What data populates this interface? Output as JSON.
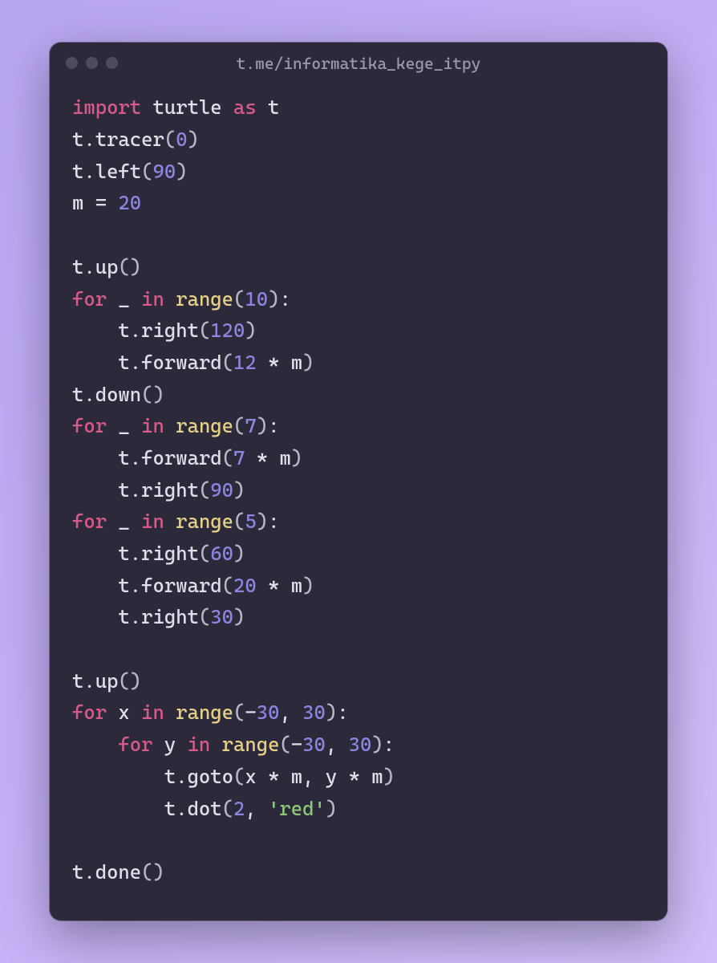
{
  "window": {
    "title": "t.me/informatika_kege_itpy"
  },
  "code": {
    "lines": [
      [
        [
          "kw",
          "import"
        ],
        [
          "var",
          " turtle "
        ],
        [
          "kw",
          "as"
        ],
        [
          "var",
          " t"
        ]
      ],
      [
        [
          "var",
          "t"
        ],
        [
          "op",
          "."
        ],
        [
          "fn",
          "tracer"
        ],
        [
          "paren",
          "("
        ],
        [
          "num",
          "0"
        ],
        [
          "paren",
          ")"
        ]
      ],
      [
        [
          "var",
          "t"
        ],
        [
          "op",
          "."
        ],
        [
          "fn",
          "left"
        ],
        [
          "paren",
          "("
        ],
        [
          "num",
          "90"
        ],
        [
          "paren",
          ")"
        ]
      ],
      [
        [
          "var",
          "m "
        ],
        [
          "op",
          "="
        ],
        [
          "var",
          " "
        ],
        [
          "num",
          "20"
        ]
      ],
      [
        [
          "var",
          ""
        ]
      ],
      [
        [
          "var",
          "t"
        ],
        [
          "op",
          "."
        ],
        [
          "fn",
          "up"
        ],
        [
          "paren",
          "()"
        ]
      ],
      [
        [
          "kw",
          "for"
        ],
        [
          "var",
          " _ "
        ],
        [
          "kw",
          "in"
        ],
        [
          "var",
          " "
        ],
        [
          "builtin",
          "range"
        ],
        [
          "paren",
          "("
        ],
        [
          "num",
          "10"
        ],
        [
          "paren",
          ")"
        ],
        [
          "op",
          ":"
        ]
      ],
      [
        [
          "var",
          "    t"
        ],
        [
          "op",
          "."
        ],
        [
          "fn",
          "right"
        ],
        [
          "paren",
          "("
        ],
        [
          "num",
          "120"
        ],
        [
          "paren",
          ")"
        ]
      ],
      [
        [
          "var",
          "    t"
        ],
        [
          "op",
          "."
        ],
        [
          "fn",
          "forward"
        ],
        [
          "paren",
          "("
        ],
        [
          "num",
          "12"
        ],
        [
          "op",
          " * "
        ],
        [
          "var",
          "m"
        ],
        [
          "paren",
          ")"
        ]
      ],
      [
        [
          "var",
          "t"
        ],
        [
          "op",
          "."
        ],
        [
          "fn",
          "down"
        ],
        [
          "paren",
          "()"
        ]
      ],
      [
        [
          "kw",
          "for"
        ],
        [
          "var",
          " _ "
        ],
        [
          "kw",
          "in"
        ],
        [
          "var",
          " "
        ],
        [
          "builtin",
          "range"
        ],
        [
          "paren",
          "("
        ],
        [
          "num",
          "7"
        ],
        [
          "paren",
          ")"
        ],
        [
          "op",
          ":"
        ]
      ],
      [
        [
          "var",
          "    t"
        ],
        [
          "op",
          "."
        ],
        [
          "fn",
          "forward"
        ],
        [
          "paren",
          "("
        ],
        [
          "num",
          "7"
        ],
        [
          "op",
          " * "
        ],
        [
          "var",
          "m"
        ],
        [
          "paren",
          ")"
        ]
      ],
      [
        [
          "var",
          "    t"
        ],
        [
          "op",
          "."
        ],
        [
          "fn",
          "right"
        ],
        [
          "paren",
          "("
        ],
        [
          "num",
          "90"
        ],
        [
          "paren",
          ")"
        ]
      ],
      [
        [
          "kw",
          "for"
        ],
        [
          "var",
          " _ "
        ],
        [
          "kw",
          "in"
        ],
        [
          "var",
          " "
        ],
        [
          "builtin",
          "range"
        ],
        [
          "paren",
          "("
        ],
        [
          "num",
          "5"
        ],
        [
          "paren",
          ")"
        ],
        [
          "op",
          ":"
        ]
      ],
      [
        [
          "var",
          "    t"
        ],
        [
          "op",
          "."
        ],
        [
          "fn",
          "right"
        ],
        [
          "paren",
          "("
        ],
        [
          "num",
          "60"
        ],
        [
          "paren",
          ")"
        ]
      ],
      [
        [
          "var",
          "    t"
        ],
        [
          "op",
          "."
        ],
        [
          "fn",
          "forward"
        ],
        [
          "paren",
          "("
        ],
        [
          "num",
          "20"
        ],
        [
          "op",
          " * "
        ],
        [
          "var",
          "m"
        ],
        [
          "paren",
          ")"
        ]
      ],
      [
        [
          "var",
          "    t"
        ],
        [
          "op",
          "."
        ],
        [
          "fn",
          "right"
        ],
        [
          "paren",
          "("
        ],
        [
          "num",
          "30"
        ],
        [
          "paren",
          ")"
        ]
      ],
      [
        [
          "var",
          ""
        ]
      ],
      [
        [
          "var",
          "t"
        ],
        [
          "op",
          "."
        ],
        [
          "fn",
          "up"
        ],
        [
          "paren",
          "()"
        ]
      ],
      [
        [
          "kw",
          "for"
        ],
        [
          "var",
          " x "
        ],
        [
          "kw",
          "in"
        ],
        [
          "var",
          " "
        ],
        [
          "builtin",
          "range"
        ],
        [
          "paren",
          "("
        ],
        [
          "op",
          "-"
        ],
        [
          "num",
          "30"
        ],
        [
          "op",
          ", "
        ],
        [
          "num",
          "30"
        ],
        [
          "paren",
          ")"
        ],
        [
          "op",
          ":"
        ]
      ],
      [
        [
          "var",
          "    "
        ],
        [
          "kw",
          "for"
        ],
        [
          "var",
          " y "
        ],
        [
          "kw",
          "in"
        ],
        [
          "var",
          " "
        ],
        [
          "builtin",
          "range"
        ],
        [
          "paren",
          "("
        ],
        [
          "op",
          "-"
        ],
        [
          "num",
          "30"
        ],
        [
          "op",
          ", "
        ],
        [
          "num",
          "30"
        ],
        [
          "paren",
          ")"
        ],
        [
          "op",
          ":"
        ]
      ],
      [
        [
          "var",
          "        t"
        ],
        [
          "op",
          "."
        ],
        [
          "fn",
          "goto"
        ],
        [
          "paren",
          "("
        ],
        [
          "var",
          "x "
        ],
        [
          "op",
          "*"
        ],
        [
          "var",
          " m"
        ],
        [
          "op",
          ", "
        ],
        [
          "var",
          "y "
        ],
        [
          "op",
          "*"
        ],
        [
          "var",
          " m"
        ],
        [
          "paren",
          ")"
        ]
      ],
      [
        [
          "var",
          "        t"
        ],
        [
          "op",
          "."
        ],
        [
          "fn",
          "dot"
        ],
        [
          "paren",
          "("
        ],
        [
          "num",
          "2"
        ],
        [
          "op",
          ", "
        ],
        [
          "str",
          "'red'"
        ],
        [
          "paren",
          ")"
        ]
      ],
      [
        [
          "var",
          ""
        ]
      ],
      [
        [
          "var",
          "t"
        ],
        [
          "op",
          "."
        ],
        [
          "fn",
          "done"
        ],
        [
          "paren",
          "()"
        ]
      ]
    ]
  }
}
